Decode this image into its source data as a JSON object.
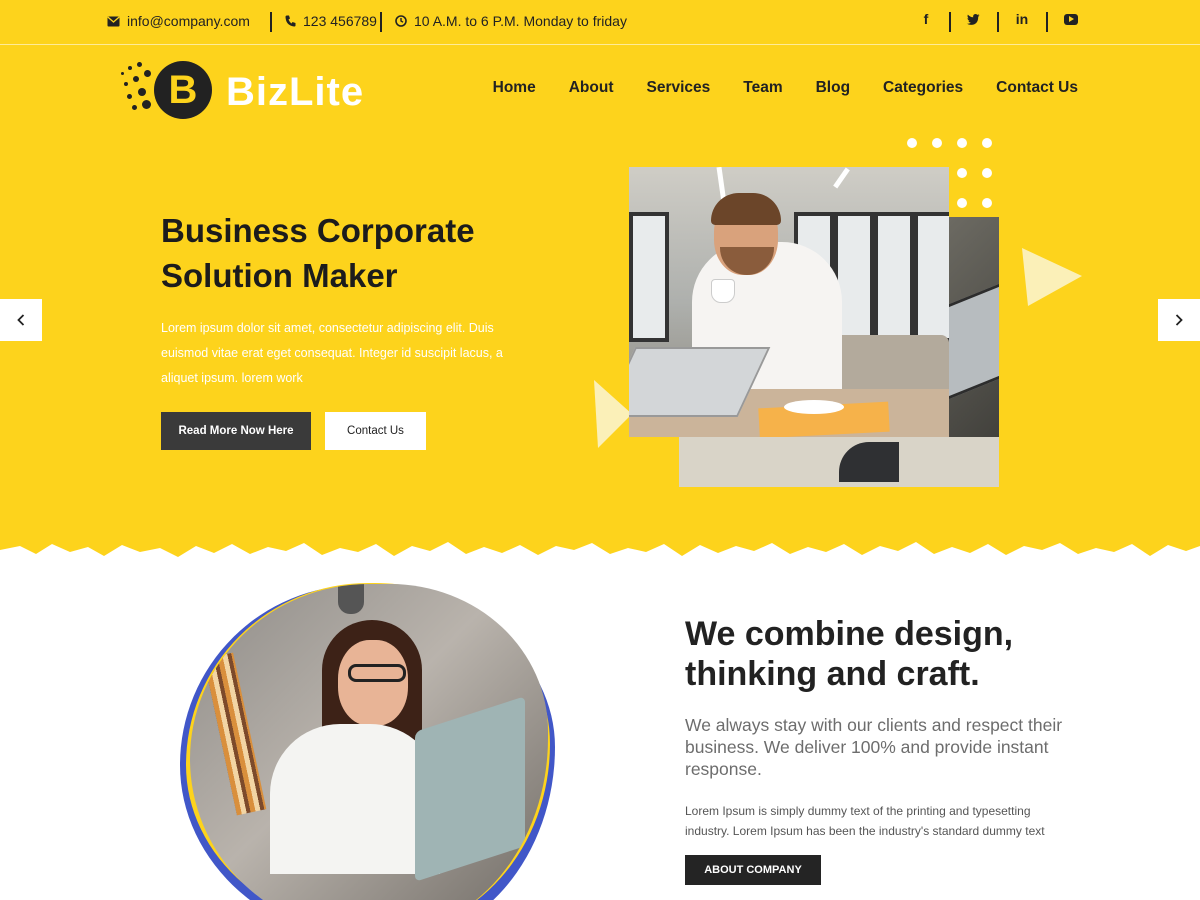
{
  "colors": {
    "brand_yellow": "#fdd31c",
    "dark": "#222222",
    "accent_blue": "#4157c8"
  },
  "topbar": {
    "email": "info@company.com",
    "phone": "123 456789",
    "hours": "10 A.M. to 6 P.M. Monday to friday",
    "social": [
      {
        "name": "facebook-icon",
        "glyph": "f"
      },
      {
        "name": "twitter-icon",
        "glyph": "t"
      },
      {
        "name": "linkedin-icon",
        "glyph": "in"
      },
      {
        "name": "youtube-icon",
        "glyph": "yt"
      }
    ]
  },
  "header": {
    "logo_letter": "B",
    "logo_text": "BizLite",
    "nav": [
      "Home",
      "About",
      "Services",
      "Team",
      "Blog",
      "Categories",
      "Contact Us"
    ]
  },
  "hero": {
    "title_line1": "Business Corporate",
    "title_line2": "Solution Maker",
    "description": "Lorem ipsum dolor sit amet, consectetur adipiscing elit. Duis euismod vitae erat eget consequat. Integer id suscipit lacus, a aliquet ipsum. lorem work",
    "primary_button": "Read More Now Here",
    "secondary_button": "Contact Us",
    "prev_arrow": "‹",
    "next_arrow": "›"
  },
  "about": {
    "title": "We combine design, thinking and craft.",
    "lead": "We always stay with our clients and respect their business. We deliver 100% and provide instant response.",
    "body": "Lorem Ipsum is simply dummy text of the printing and typesetting industry. Lorem Ipsum has been the industry's standard dummy text",
    "button": "ABOUT COMPANY"
  }
}
